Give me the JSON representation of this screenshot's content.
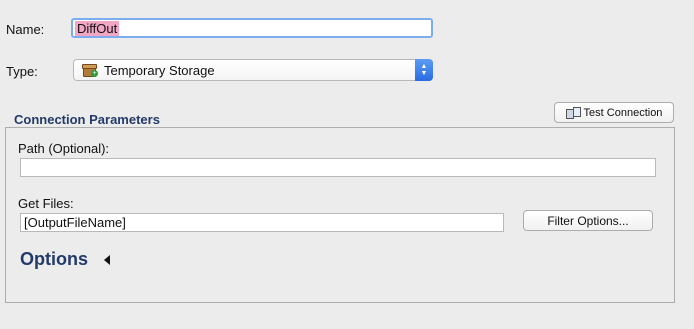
{
  "form": {
    "name_label": "Name:",
    "name_value": "DiffOut",
    "type_label": "Type:",
    "type_value": "Temporary Storage",
    "type_icon": "temporary-storage-icon"
  },
  "connection": {
    "section_title": "Connection Parameters",
    "test_button_label": "Test Connection",
    "path_label": "Path (Optional):",
    "path_value": "",
    "get_files_label": "Get Files:",
    "get_files_value": "[OutputFileName]",
    "filter_button_label": "Filter Options...",
    "options_label": "Options"
  },
  "colors": {
    "selection_highlight": "#f2a6c4",
    "focus_ring": "#7aaef0",
    "section_title": "#233a6a"
  }
}
